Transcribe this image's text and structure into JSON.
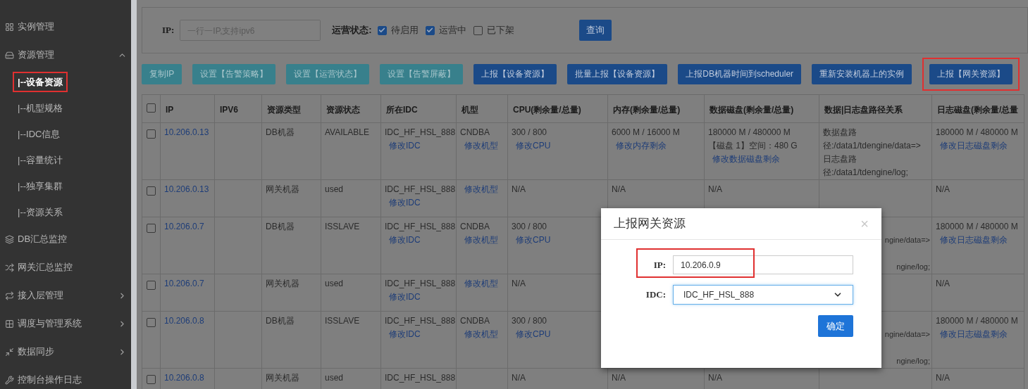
{
  "sidebar": {
    "items": [
      {
        "label": "实例管理",
        "kind": "link",
        "selected": false
      },
      {
        "label": "资源管理",
        "kind": "group",
        "expanded": true,
        "selected": false,
        "children": [
          {
            "label": "|--设备资源",
            "selected": true
          },
          {
            "label": "|--机型规格",
            "selected": false
          },
          {
            "label": "|--IDC信息",
            "selected": false
          },
          {
            "label": "|--容量统计",
            "selected": false
          },
          {
            "label": "|--独享集群",
            "selected": false
          },
          {
            "label": "|--资源关系",
            "selected": false
          }
        ]
      },
      {
        "label": "DB汇总监控",
        "kind": "link",
        "selected": false
      },
      {
        "label": "网关汇总监控",
        "kind": "link",
        "selected": false
      },
      {
        "label": "接入层管理",
        "kind": "group",
        "expanded": false,
        "selected": false
      },
      {
        "label": "调度与管理系统",
        "kind": "group",
        "expanded": false,
        "selected": false
      },
      {
        "label": "数据同步",
        "kind": "group",
        "expanded": false,
        "selected": false
      },
      {
        "label": "控制台操作日志",
        "kind": "link",
        "selected": false
      }
    ]
  },
  "filter": {
    "ip_label": "IP:",
    "ip_placeholder": "一行一IP,支持ipv6",
    "status_label": "运营状态:",
    "statuses": [
      {
        "label": "待启用",
        "checked": true
      },
      {
        "label": "运营中",
        "checked": true
      },
      {
        "label": "已下架",
        "checked": false
      }
    ],
    "query_button": "查询"
  },
  "toolbar": [
    {
      "label": "复制IP",
      "kind": "info",
      "highlighted": false
    },
    {
      "label": "设置【告警策略】",
      "kind": "info",
      "highlighted": false
    },
    {
      "label": "设置【运营状态】",
      "kind": "info",
      "highlighted": false
    },
    {
      "label": "设置【告警屏蔽】",
      "kind": "info",
      "highlighted": false
    },
    {
      "label": "上报【设备资源】",
      "kind": "primary",
      "highlighted": false
    },
    {
      "label": "批量上报【设备资源】",
      "kind": "primary",
      "highlighted": false
    },
    {
      "label": "上报DB机器时间到scheduler",
      "kind": "primary",
      "highlighted": false
    },
    {
      "label": "重新安装机器上的实例",
      "kind": "primary",
      "highlighted": false
    },
    {
      "label": "上报【网关资源】",
      "kind": "primary",
      "highlighted": true
    }
  ],
  "table": {
    "select_all": {
      "checked": false
    },
    "columns": [
      "IP",
      "IPV6",
      "资源类型",
      "资源状态",
      "所在IDC",
      "机型",
      "CPU(剩余量/总量)",
      "内存(剩余量/总量)",
      "数据磁盘(剩余量/总量)",
      "数据|日志盘路径关系",
      "日志磁盘(剩余量/总量"
    ],
    "rows": [
      {
        "selected": false,
        "cells": [
          [
            {
              "kind": "link",
              "text": "10.206.0.13"
            }
          ],
          [],
          [
            {
              "kind": "text",
              "text": "DB机器"
            }
          ],
          [
            {
              "kind": "text",
              "text": "AVAILABLE"
            }
          ],
          [
            {
              "kind": "text",
              "text": "IDC_HF_HSL_888"
            },
            {
              "kind": "link",
              "text": "修改IDC"
            }
          ],
          [
            {
              "kind": "text",
              "text": "CNDBA"
            },
            {
              "kind": "link",
              "text": "修改机型"
            }
          ],
          [
            {
              "kind": "text",
              "text": "300 / 800"
            },
            {
              "kind": "link",
              "text": "修改CPU"
            }
          ],
          [
            {
              "kind": "text",
              "text": "6000 M / 16000 M"
            },
            {
              "kind": "link",
              "text": "修改内存剩余"
            }
          ],
          [
            {
              "kind": "text",
              "text": "180000 M / 480000 M"
            },
            {
              "kind": "text",
              "text": "【磁盘 1】空间：480 G"
            },
            {
              "kind": "link",
              "text": "修改数据磁盘剩余"
            }
          ],
          [
            {
              "kind": "path",
              "text": "数据盘路径:/data1/tdengine/data=>"
            },
            {
              "kind": "path",
              "text": "日志盘路径:/data1/tdengine/log;"
            }
          ],
          [
            {
              "kind": "text",
              "text": "180000 M / 480000 M"
            },
            {
              "kind": "link",
              "text": "修改日志磁盘剩余"
            }
          ]
        ]
      },
      {
        "selected": false,
        "cells": [
          [
            {
              "kind": "link",
              "text": "10.206.0.13"
            }
          ],
          [],
          [
            {
              "kind": "text",
              "text": "网关机器"
            }
          ],
          [
            {
              "kind": "text",
              "text": "used"
            }
          ],
          [
            {
              "kind": "text",
              "text": "IDC_HF_HSL_888"
            },
            {
              "kind": "link",
              "text": "修改IDC"
            }
          ],
          [
            {
              "kind": "link",
              "text": "修改机型"
            }
          ],
          [
            {
              "kind": "text",
              "text": "N/A"
            }
          ],
          [
            {
              "kind": "text",
              "text": "N/A"
            }
          ],
          [
            {
              "kind": "text",
              "text": "N/A"
            }
          ],
          [],
          [
            {
              "kind": "text",
              "text": "N/A"
            }
          ]
        ]
      },
      {
        "selected": false,
        "cells": [
          [
            {
              "kind": "link",
              "text": "10.206.0.7"
            }
          ],
          [],
          [
            {
              "kind": "text",
              "text": "DB机器"
            }
          ],
          [
            {
              "kind": "text",
              "text": "ISSLAVE"
            }
          ],
          [
            {
              "kind": "text",
              "text": "IDC_HF_HSL_888"
            },
            {
              "kind": "link",
              "text": "修改IDC"
            }
          ],
          [
            {
              "kind": "text",
              "text": "CNDBA"
            },
            {
              "kind": "link",
              "text": "修改机型"
            }
          ],
          [
            {
              "kind": "text",
              "text": "300 / 800"
            },
            {
              "kind": "link",
              "text": "修改CPU"
            }
          ],
          [],
          [],
          [
            {
              "kind": "gap"
            },
            {
              "kind": "clipped",
              "text": "ngine/data=>"
            },
            {
              "kind": "gap"
            },
            {
              "kind": "clipped",
              "text": "ngine/log;"
            }
          ],
          [
            {
              "kind": "text",
              "text": "180000 M / 480000 M"
            },
            {
              "kind": "link",
              "text": "修改日志磁盘剩余"
            }
          ]
        ]
      },
      {
        "selected": false,
        "cells": [
          [
            {
              "kind": "link",
              "text": "10.206.0.7"
            }
          ],
          [],
          [
            {
              "kind": "text",
              "text": "网关机器"
            }
          ],
          [
            {
              "kind": "text",
              "text": "used"
            }
          ],
          [
            {
              "kind": "text",
              "text": "IDC_HF_HSL_888"
            },
            {
              "kind": "link",
              "text": "修改IDC"
            }
          ],
          [
            {
              "kind": "link",
              "text": "修改机型"
            }
          ],
          [
            {
              "kind": "text",
              "text": "N/A"
            }
          ],
          [],
          [],
          [],
          [
            {
              "kind": "text",
              "text": "N/A"
            }
          ]
        ]
      },
      {
        "selected": false,
        "cells": [
          [
            {
              "kind": "link",
              "text": "10.206.0.8"
            }
          ],
          [],
          [
            {
              "kind": "text",
              "text": "DB机器"
            }
          ],
          [
            {
              "kind": "text",
              "text": "ISSLAVE"
            }
          ],
          [
            {
              "kind": "text",
              "text": "IDC_HF_HSL_888"
            },
            {
              "kind": "link",
              "text": "修改IDC"
            }
          ],
          [
            {
              "kind": "text",
              "text": "CNDBA"
            },
            {
              "kind": "link",
              "text": "修改机型"
            }
          ],
          [
            {
              "kind": "text",
              "text": "300 / 800"
            },
            {
              "kind": "link",
              "text": "修改CPU"
            }
          ],
          [],
          [],
          [
            {
              "kind": "gap"
            },
            {
              "kind": "clipped",
              "text": "ngine/data=>"
            },
            {
              "kind": "gap"
            },
            {
              "kind": "clipped",
              "text": "ngine/log;"
            }
          ],
          [
            {
              "kind": "text",
              "text": "180000 M / 480000 M"
            },
            {
              "kind": "link",
              "text": "修改日志磁盘剩余"
            }
          ]
        ]
      },
      {
        "selected": false,
        "cells": [
          [
            {
              "kind": "link",
              "text": "10.206.0.8"
            }
          ],
          [],
          [
            {
              "kind": "text",
              "text": "网关机器"
            }
          ],
          [
            {
              "kind": "text",
              "text": "used"
            }
          ],
          [
            {
              "kind": "text",
              "text": "IDC_HF_HSL_888"
            }
          ],
          [],
          [
            {
              "kind": "text",
              "text": "N/A"
            }
          ],
          [
            {
              "kind": "text",
              "text": "N/A"
            }
          ],
          [
            {
              "kind": "text",
              "text": "N/A"
            }
          ],
          [],
          [
            {
              "kind": "text",
              "text": "N/A"
            }
          ]
        ]
      }
    ]
  },
  "dialog": {
    "title": "上报网关资源",
    "close": "×",
    "ip_label": "IP:",
    "ip_value": "10.206.0.9",
    "ip_highlighted": true,
    "idc_label": "IDC:",
    "idc_value": "IDC_HF_HSL_888",
    "confirm": "确定"
  }
}
